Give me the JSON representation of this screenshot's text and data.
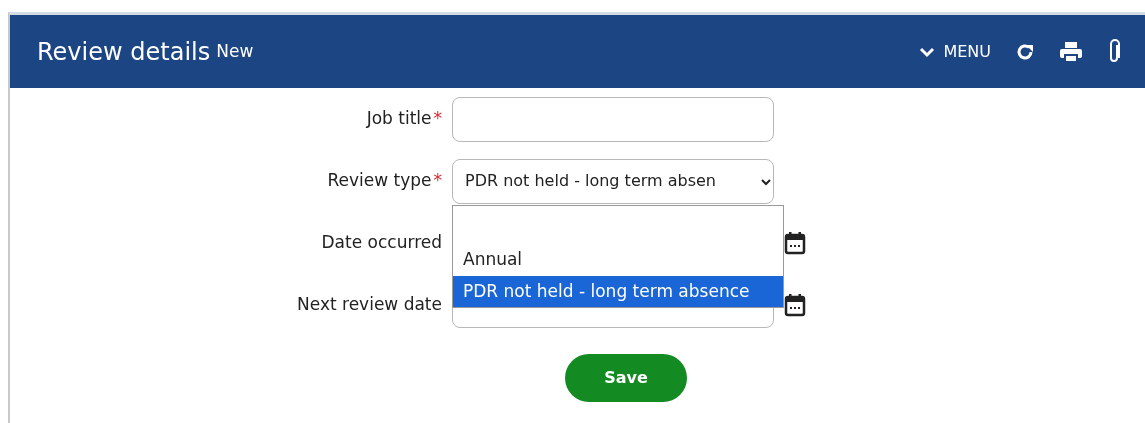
{
  "header": {
    "title": "Review details",
    "badge": "New",
    "menu": "MENU"
  },
  "fields": [
    {
      "label": "Job title",
      "required_mark": "*",
      "kind": "text"
    },
    {
      "label": "Review type",
      "required_mark": "*",
      "kind": "select",
      "value": "PDR not held - long term absen"
    },
    {
      "label": "Date occurred",
      "kind": "date",
      "covered": true
    },
    {
      "label": "Next review date",
      "kind": "date"
    }
  ],
  "dropdown": {
    "options": [
      {
        "label": "Annual",
        "selected": false
      },
      {
        "label": "PDR not held - long term absence",
        "selected": true
      }
    ]
  },
  "buttons": [
    {
      "label": "Save"
    }
  ]
}
